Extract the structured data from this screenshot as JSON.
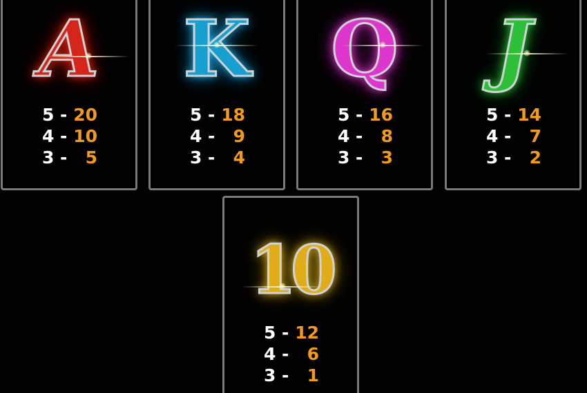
{
  "paytable": {
    "cards": [
      {
        "symbol": "A",
        "symbol_icon": "letter-a-symbol-icon",
        "color": "#e0281a",
        "glow": "#ff3a1f",
        "pays": [
          {
            "count": "5",
            "dash": "-",
            "value": "20"
          },
          {
            "count": "4",
            "dash": "-",
            "value": "10"
          },
          {
            "count": "3",
            "dash": "-",
            "value": "5"
          }
        ]
      },
      {
        "symbol": "K",
        "symbol_icon": "letter-k-symbol-icon",
        "color": "#1aa8d8",
        "glow": "#2ec6ff",
        "pays": [
          {
            "count": "5",
            "dash": "-",
            "value": "18"
          },
          {
            "count": "4",
            "dash": "-",
            "value": "9"
          },
          {
            "count": "3",
            "dash": "-",
            "value": "4"
          }
        ]
      },
      {
        "symbol": "Q",
        "symbol_icon": "letter-q-symbol-icon",
        "color": "#e23ad0",
        "glow": "#ff4ee8",
        "pays": [
          {
            "count": "5",
            "dash": "-",
            "value": "16"
          },
          {
            "count": "4",
            "dash": "-",
            "value": "8"
          },
          {
            "count": "3",
            "dash": "-",
            "value": "3"
          }
        ]
      },
      {
        "symbol": "J",
        "symbol_icon": "letter-j-symbol-icon",
        "color": "#2ec43a",
        "glow": "#39e04a",
        "pays": [
          {
            "count": "5",
            "dash": "-",
            "value": "14"
          },
          {
            "count": "4",
            "dash": "-",
            "value": "7"
          },
          {
            "count": "3",
            "dash": "-",
            "value": "2"
          }
        ]
      },
      {
        "symbol": "10",
        "symbol_icon": "number-ten-symbol-icon",
        "color": "#e3b21a",
        "glow": "#ffd23a",
        "pays": [
          {
            "count": "5",
            "dash": "-",
            "value": "12"
          },
          {
            "count": "4",
            "dash": "-",
            "value": "6"
          },
          {
            "count": "3",
            "dash": "-",
            "value": "1"
          }
        ]
      }
    ],
    "colors": {
      "background": "#000000",
      "border": "#7a7a7a",
      "count_text": "#ffffff",
      "value_text": "#f39a1a"
    }
  }
}
